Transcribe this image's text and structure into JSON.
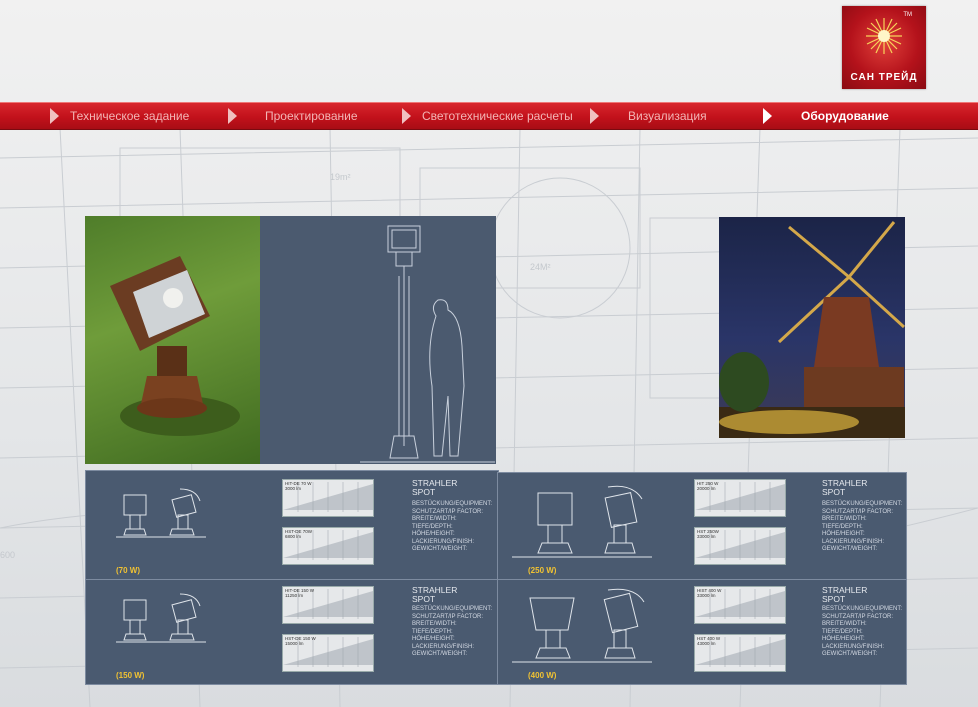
{
  "brand": {
    "name": "САН ТРЕЙД",
    "tm": "TM"
  },
  "nav": {
    "items": [
      {
        "label": "Техническое задание"
      },
      {
        "label": "Проектирование"
      },
      {
        "label": "Светотехнические расчеты"
      },
      {
        "label": "Визуализация"
      },
      {
        "label": "Оборудование",
        "active": true
      }
    ]
  },
  "spec_common": {
    "title_1": "STRAHLER",
    "title_2": "SPOT",
    "fields": [
      "BESTÜCKUNG/EQUIPMENT:",
      "SCHUTZART/IP FACTOR:",
      "BREITE/WIDTH:",
      "TIEFE/DEPTH:",
      "HÖHE/HEIGHT:",
      "LACKIERUNG/FINISH:",
      "GEWICHT/WEIGHT:"
    ]
  },
  "spec_cards": [
    {
      "watt": "(70 W)",
      "charts": [
        "HIT-DE 70 W\n3000 lm",
        "HST-DE 70W\n6800 lm"
      ]
    },
    {
      "watt": "(150 W)",
      "charts": [
        "HIT-DE 150 W\n11250 lm",
        "HST-DE 150 W\n15000 lm"
      ]
    },
    {
      "watt": "(250 W)",
      "charts": [
        "HIT 250 W\n20000 lm",
        "HST 250W\n33000 lm"
      ]
    },
    {
      "watt": "(400 W)",
      "charts": [
        "HIST 400 W\n33000 lm",
        "HST 400 W\n43000 lm"
      ]
    }
  ],
  "colors": {
    "nav_red": "#c2111b",
    "panel": "#4b5a6f",
    "accent_yellow": "#f1c232"
  }
}
